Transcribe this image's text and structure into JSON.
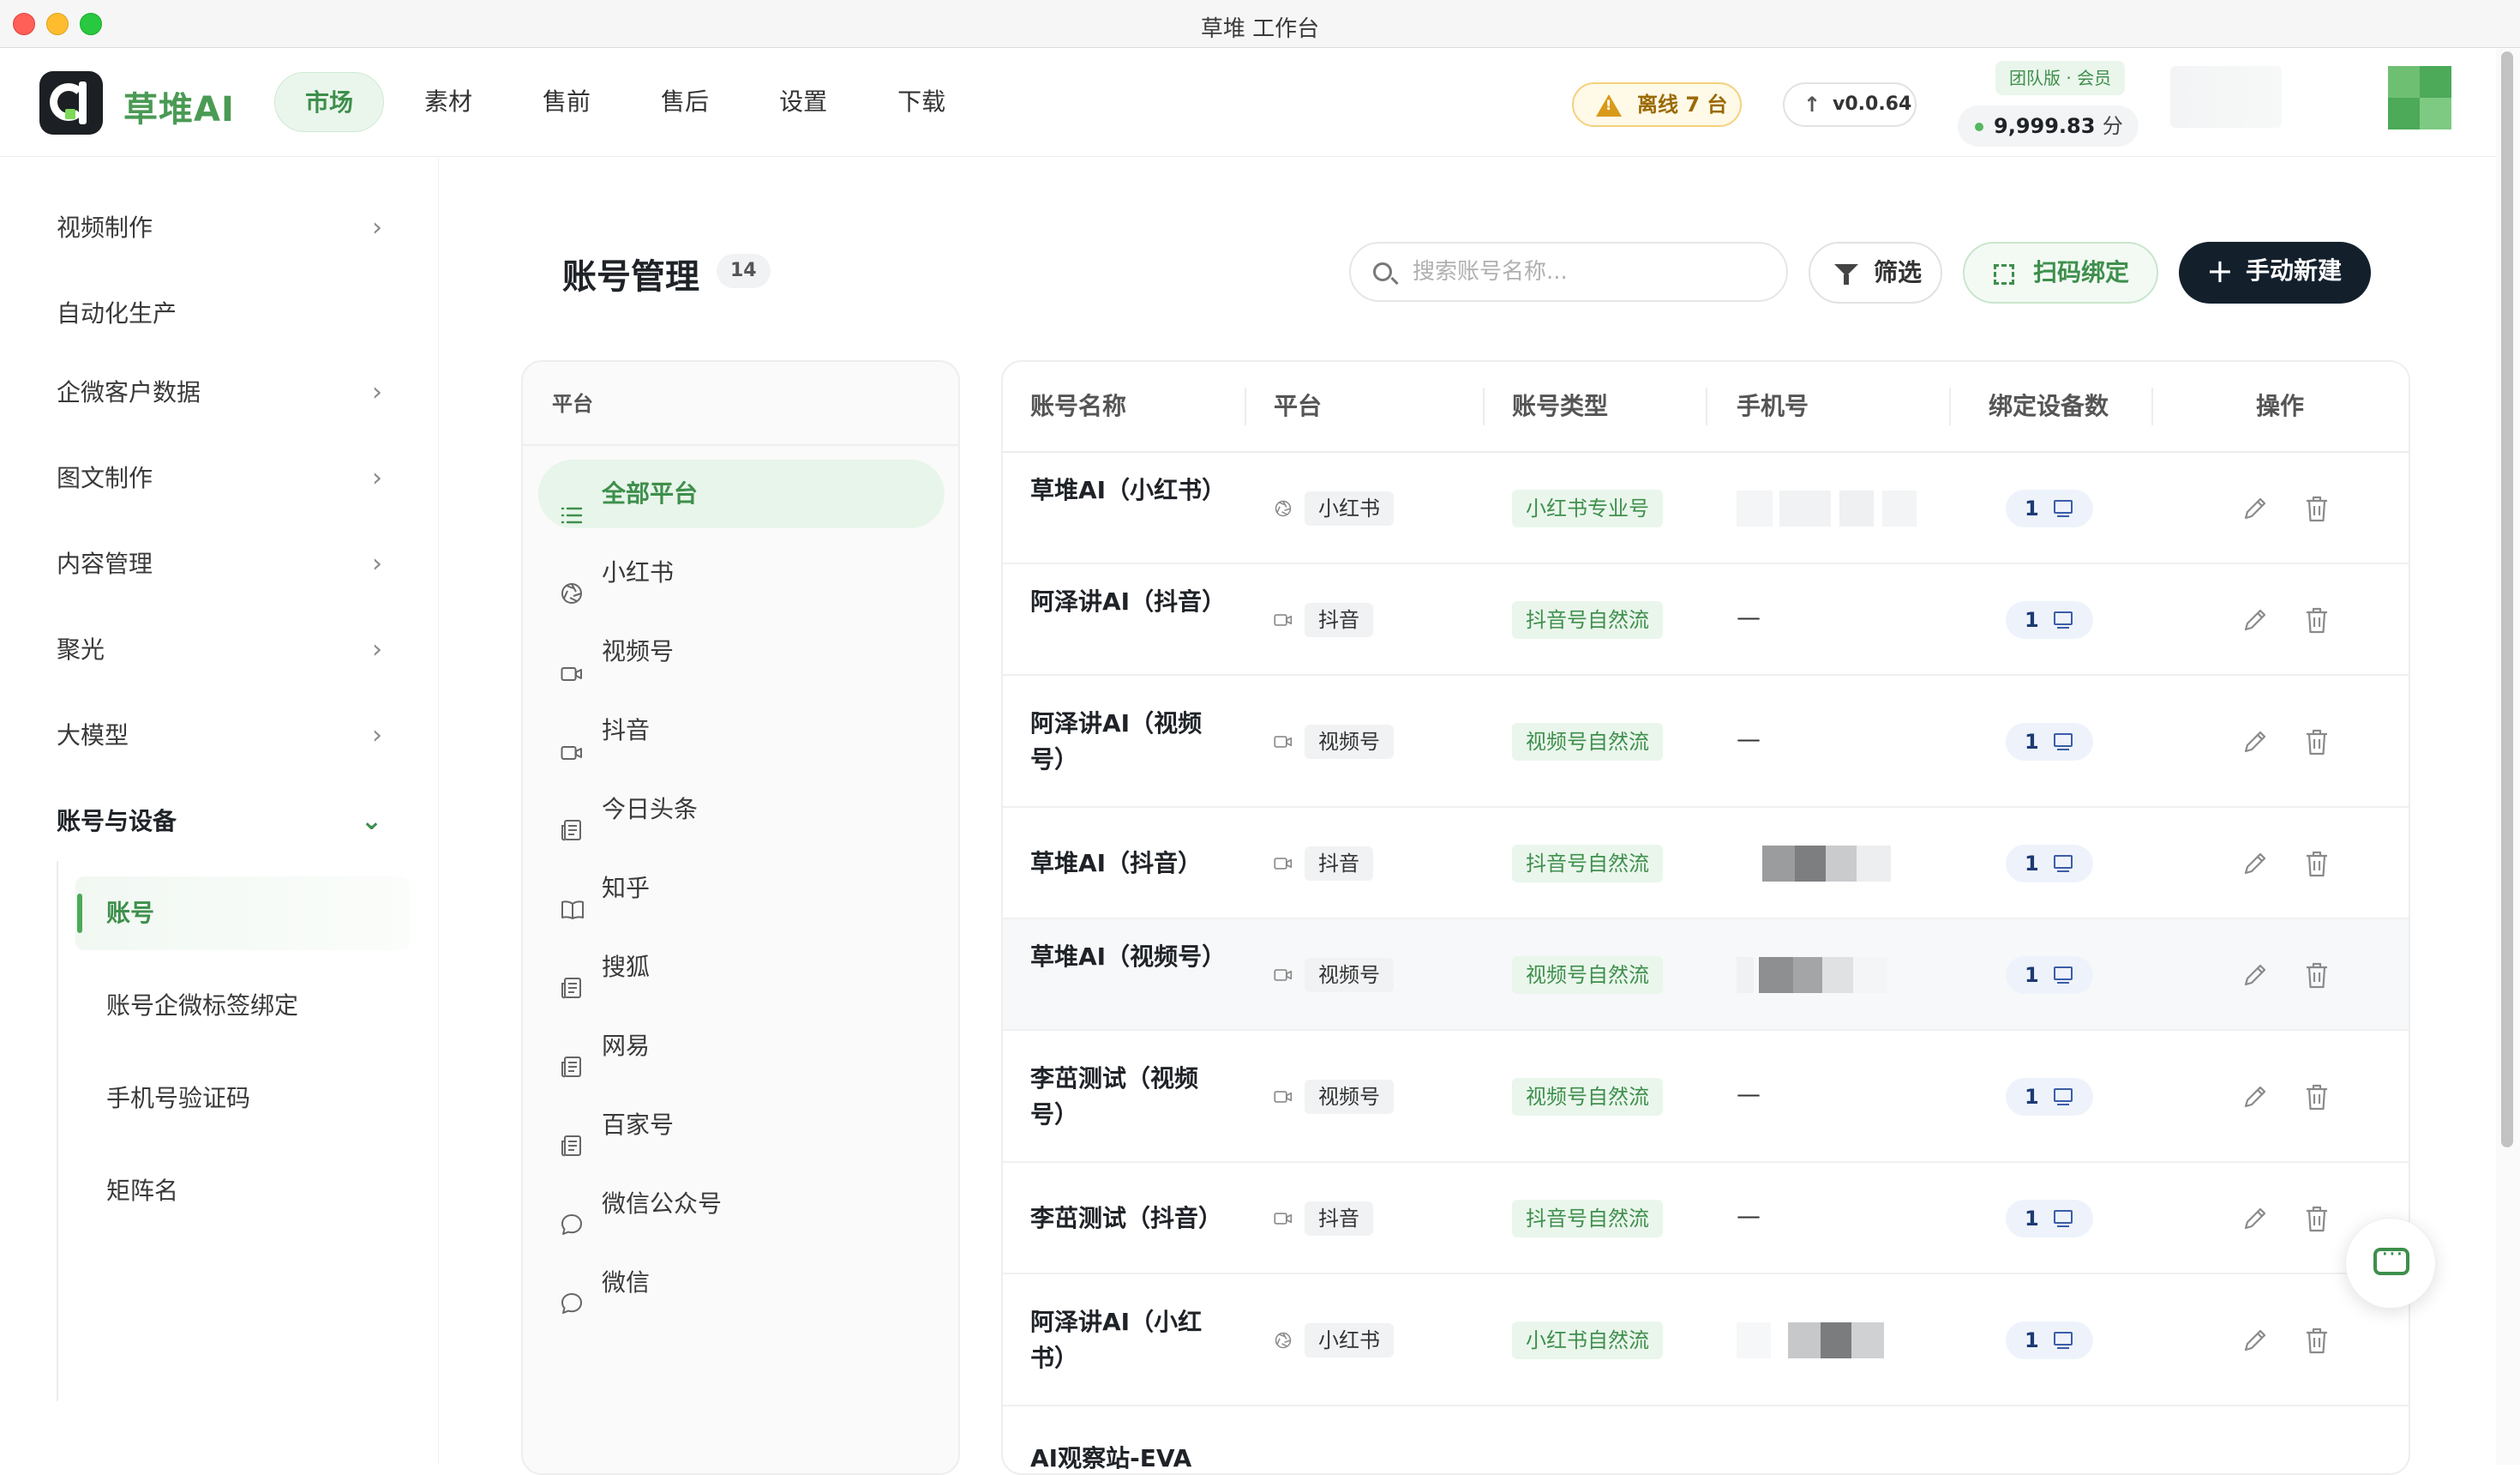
{
  "window": {
    "title": "草堆 工作台"
  },
  "header": {
    "brand": "草堆AI",
    "nav": [
      "市场",
      "素材",
      "售前",
      "售后",
      "设置",
      "下载"
    ],
    "offline": "离线 7 台",
    "version": "v0.0.64",
    "team_badge": "团队版 · 会员",
    "points_value": "9,999.83",
    "points_unit": "分"
  },
  "sidebar": {
    "items": [
      {
        "label": "视频制作",
        "expandable": true
      },
      {
        "label": "自动化生产",
        "expandable": false
      },
      {
        "label": "企微客户数据",
        "expandable": true
      },
      {
        "label": "图文制作",
        "expandable": true
      },
      {
        "label": "内容管理",
        "expandable": true
      },
      {
        "label": "聚光",
        "expandable": true
      },
      {
        "label": "大模型",
        "expandable": true
      },
      {
        "label": "账号与设备",
        "expandable": true,
        "open": true
      }
    ],
    "sub_items": [
      "账号",
      "账号企微标签绑定",
      "手机号验证码",
      "矩阵名"
    ],
    "active_sub": "账号"
  },
  "page": {
    "title": "账号管理",
    "count": "14",
    "search_placeholder": "搜索账号名称...",
    "filter_label": "筛选",
    "scan_label": "扫码绑定",
    "new_label": "手动新建"
  },
  "platforms": {
    "header": "平台",
    "items": [
      {
        "label": "全部平台",
        "icon": "list-icon",
        "active": true
      },
      {
        "label": "小红书",
        "icon": "aperture-icon"
      },
      {
        "label": "视频号",
        "icon": "video-icon"
      },
      {
        "label": "抖音",
        "icon": "video-icon"
      },
      {
        "label": "今日头条",
        "icon": "newspaper-icon"
      },
      {
        "label": "知乎",
        "icon": "book-icon"
      },
      {
        "label": "搜狐",
        "icon": "newspaper-icon"
      },
      {
        "label": "网易",
        "icon": "newspaper-icon"
      },
      {
        "label": "百家号",
        "icon": "newspaper-icon"
      },
      {
        "label": "微信公众号",
        "icon": "chat-icon"
      },
      {
        "label": "微信",
        "icon": "chat-icon"
      }
    ]
  },
  "table": {
    "columns": [
      "账号名称",
      "平台",
      "账号类型",
      "手机号",
      "绑定设备数",
      "操作"
    ],
    "rows": [
      {
        "name": "草堆AI（小红书）",
        "platform": "小红书",
        "platform_icon": "aperture-icon",
        "type": "小红书专业号",
        "phone": "blurred",
        "devices": "1"
      },
      {
        "name": "阿泽讲AI（抖音）",
        "platform": "抖音",
        "platform_icon": "video-icon",
        "type": "抖音号自然流",
        "phone": "—",
        "devices": "1"
      },
      {
        "name": "阿泽讲AI（视频号）",
        "platform": "视频号",
        "platform_icon": "video-icon",
        "type": "视频号自然流",
        "phone": "—",
        "devices": "1"
      },
      {
        "name": "草堆AI（抖音）",
        "platform": "抖音",
        "platform_icon": "video-icon",
        "type": "抖音号自然流",
        "phone": "blurred",
        "devices": "1"
      },
      {
        "name": "草堆AI（视频号）",
        "platform": "视频号",
        "platform_icon": "video-icon",
        "type": "视频号自然流",
        "phone": "blurred",
        "devices": "1"
      },
      {
        "name": "李茁测试（视频号）",
        "platform": "视频号",
        "platform_icon": "video-icon",
        "type": "视频号自然流",
        "phone": "—",
        "devices": "1"
      },
      {
        "name": "李茁测试（抖音）",
        "platform": "抖音",
        "platform_icon": "video-icon",
        "type": "抖音号自然流",
        "phone": "—",
        "devices": "1"
      },
      {
        "name": "阿泽讲AI（小红书）",
        "platform": "小红书",
        "platform_icon": "aperture-icon",
        "type": "小红书自然流",
        "phone": "blurred",
        "devices": "1"
      },
      {
        "name": "AI观察站-EVA",
        "platform": "",
        "platform_icon": "",
        "type": "",
        "phone": "",
        "devices": ""
      }
    ]
  },
  "colors": {
    "brand_green": "#3e8f4c",
    "primary_dark": "#13202c",
    "warning": "#d99a1a",
    "device_badge": "#1d3a74"
  }
}
